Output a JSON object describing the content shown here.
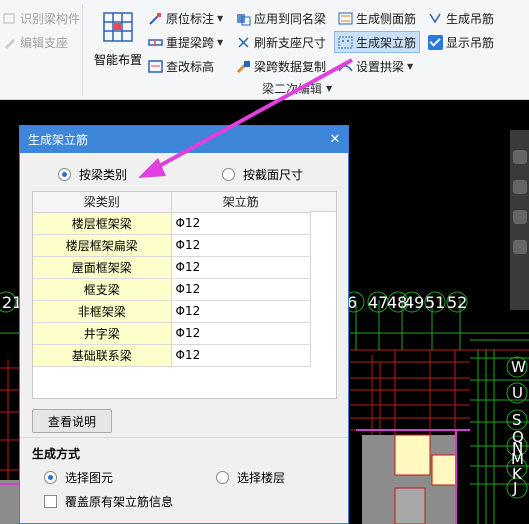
{
  "ribbon": {
    "left_items": [
      {
        "label": "识别梁构件",
        "disabled": true
      },
      {
        "label": "编辑支座",
        "disabled": true
      }
    ],
    "big_button": {
      "label": "智能布置"
    },
    "col2": [
      {
        "label": "原位标注",
        "dropdown": true
      },
      {
        "label": "重提梁跨",
        "dropdown": true
      },
      {
        "label": "查改标高"
      }
    ],
    "col3": [
      {
        "label": "应用到同名梁"
      },
      {
        "label": "刷新支座尺寸"
      },
      {
        "label": "梁跨数据复制"
      }
    ],
    "col4": [
      {
        "label": "生成侧面筋"
      },
      {
        "label": "生成架立筋"
      },
      {
        "label": "设置拱梁",
        "dropdown": true
      }
    ],
    "col5": [
      {
        "label": "生成吊筋"
      },
      {
        "label": "显示吊筋"
      }
    ],
    "group_label": "梁二次编辑"
  },
  "dialog": {
    "title": "生成架立筋",
    "radio_by_type": "按梁类别",
    "radio_by_size": "按截面尺寸",
    "table": {
      "headers": [
        "梁类别",
        "架立筋"
      ],
      "rows": [
        {
          "type": "楼层框架梁",
          "value": "Φ12"
        },
        {
          "type": "楼层框架扁梁",
          "value": "Φ12"
        },
        {
          "type": "屋面框架梁",
          "value": "Φ12"
        },
        {
          "type": "框支梁",
          "value": "Φ12"
        },
        {
          "type": "非框架梁",
          "value": "Φ12"
        },
        {
          "type": "井字梁",
          "value": "Φ12"
        },
        {
          "type": "基础联系梁",
          "value": "Φ12"
        }
      ]
    },
    "view_help_button": "查看说明",
    "generate_section": "生成方式",
    "radio_select_element": "选择图元",
    "radio_select_floor": "选择楼层",
    "overwrite_checkbox": "覆盖原有架立筋信息"
  },
  "cad_labels": {
    "left_num": "21",
    "top_nums": [
      "6",
      "47",
      "48",
      "49",
      "51",
      "52"
    ],
    "side_letters": [
      "W",
      "U",
      "S",
      "Q",
      "N",
      "M",
      "K",
      "J"
    ]
  },
  "colors": {
    "ribbon_bg": "#f5f6f7",
    "dialog_title": "#3d86da",
    "table_highlight": "#ffffcc",
    "arrow": "#e040e0",
    "cad_bg": "#000000"
  }
}
